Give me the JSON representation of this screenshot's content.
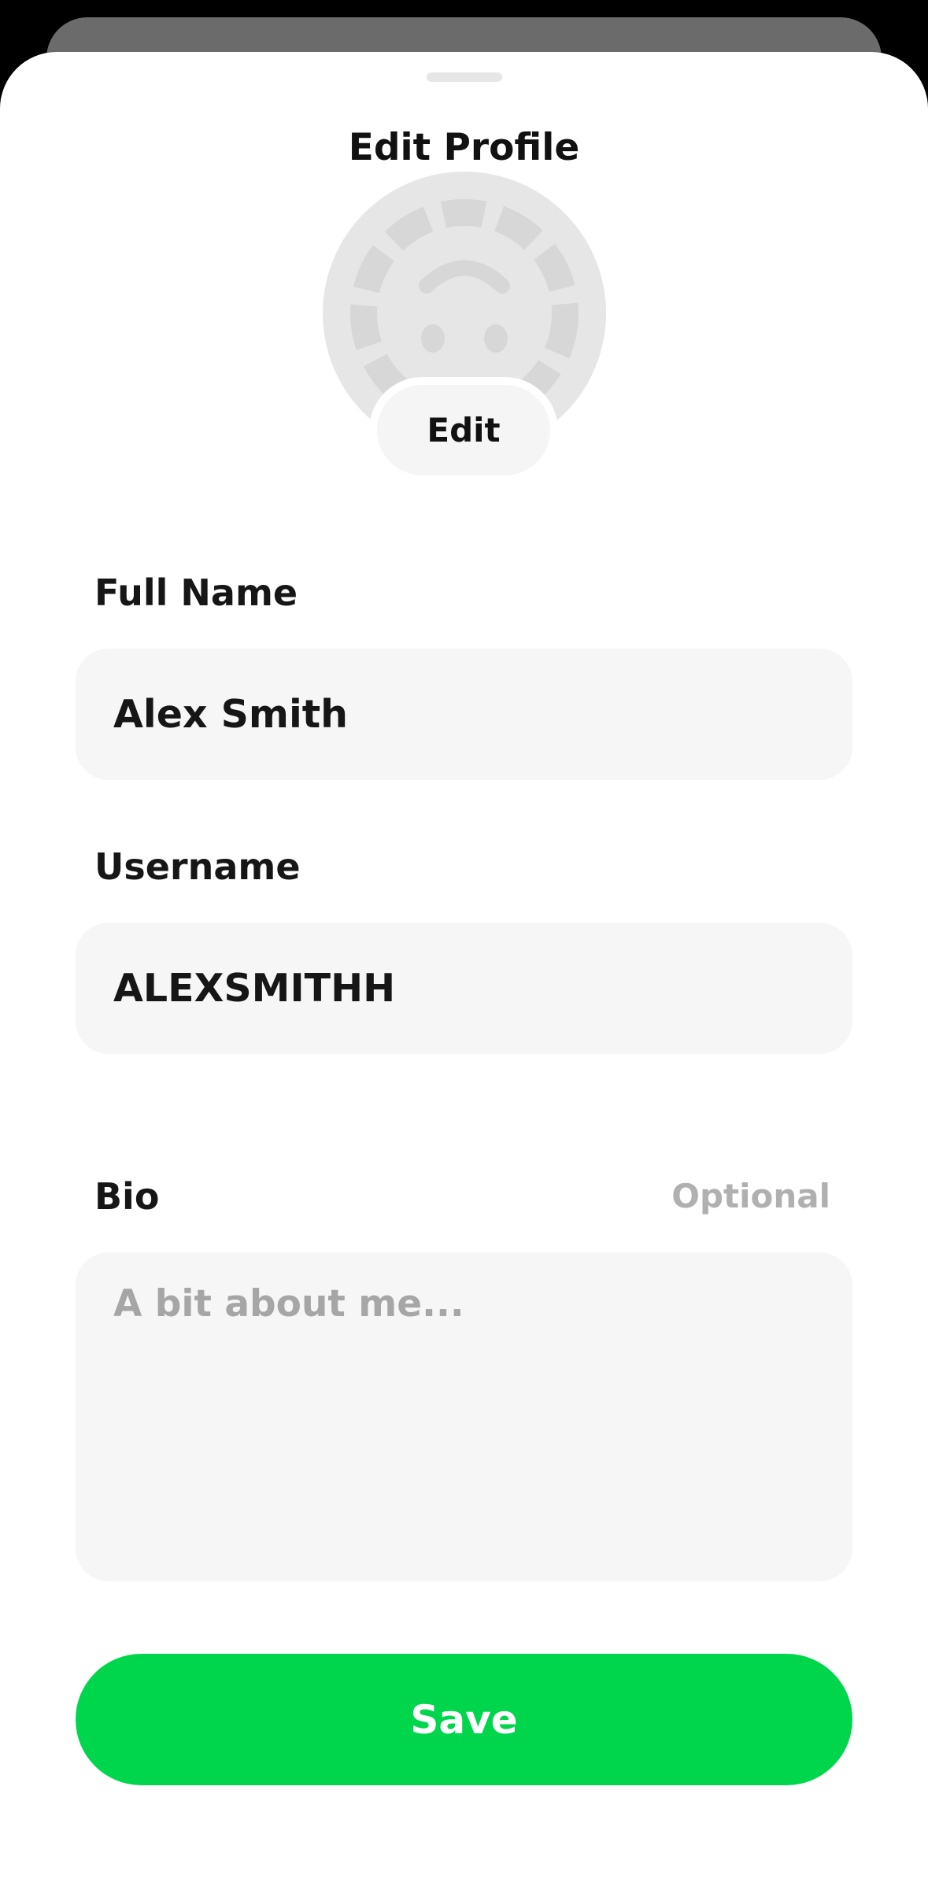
{
  "header": {
    "title": "Edit Profile"
  },
  "avatar": {
    "icon": "avatar-placeholder-icon",
    "edit_label": "Edit"
  },
  "form": {
    "full_name": {
      "label": "Full Name",
      "value": "Alex Smith"
    },
    "username": {
      "label": "Username",
      "value": "ALEXSMITHH"
    },
    "bio": {
      "label": "Bio",
      "optional_label": "Optional",
      "placeholder": "A bit about me..."
    }
  },
  "actions": {
    "save_label": "Save"
  },
  "colors": {
    "accent": "#00D64B",
    "field_background": "#F6F6F6",
    "placeholder_text": "#A6A6A6"
  }
}
